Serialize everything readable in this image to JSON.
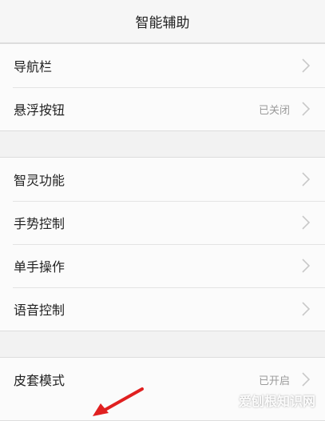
{
  "header": {
    "title": "智能辅助"
  },
  "groups": [
    {
      "items": [
        {
          "label": "导航栏",
          "value": ""
        },
        {
          "label": "悬浮按钮",
          "value": "已关闭"
        }
      ]
    },
    {
      "items": [
        {
          "label": "智灵功能",
          "value": ""
        },
        {
          "label": "手势控制",
          "value": ""
        },
        {
          "label": "单手操作",
          "value": ""
        },
        {
          "label": "语音控制",
          "value": ""
        }
      ]
    },
    {
      "items": [
        {
          "label": "皮套模式",
          "value": "已开启"
        }
      ]
    }
  ],
  "watermark": "爱刨根知识网",
  "colors": {
    "annotation_arrow": "#e02020",
    "value_text": "#9a9a9a",
    "chevron": "#c8c8c8"
  },
  "icons": {
    "chevron": "chevron-right-icon"
  }
}
